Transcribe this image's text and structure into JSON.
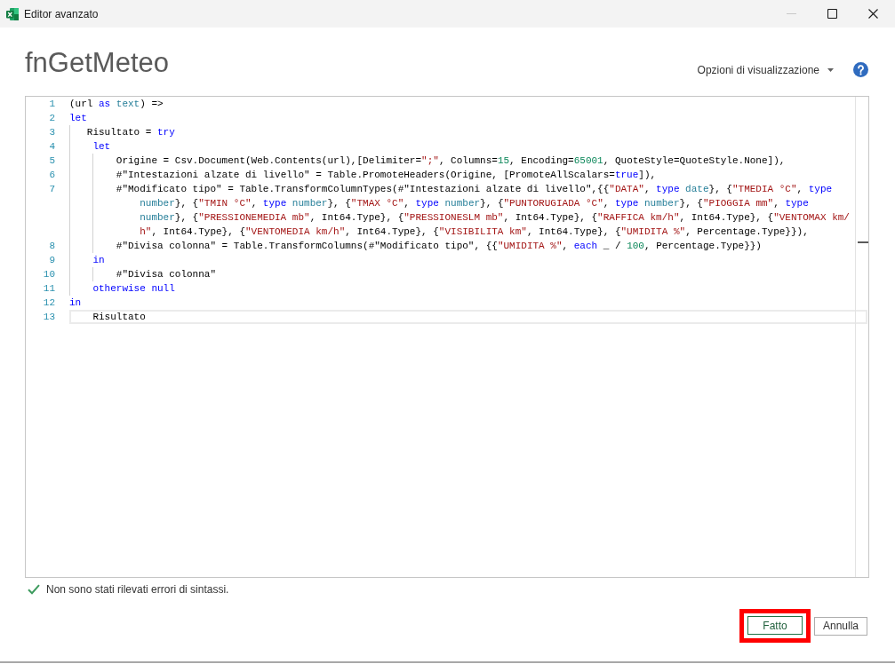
{
  "window": {
    "title": "Editor avanzato",
    "controls": [
      {
        "kind": "minimize",
        "disabled": true
      },
      {
        "kind": "maximize",
        "disabled": false
      },
      {
        "kind": "close",
        "disabled": false
      }
    ]
  },
  "query_title": "fnGetMeteo",
  "view_options": {
    "label": "Opzioni di visualizzazione"
  },
  "editor": {
    "lines": [
      {
        "number": "1",
        "current": false,
        "rows": [
          {
            "tokens": [
              {
                "text": "(url ",
                "kind": "plain"
              },
              {
                "text": "as",
                "kind": "keyword"
              },
              {
                "text": " text",
                "kind": "type"
              },
              {
                "text": ") =>",
                "kind": "plain"
              }
            ]
          }
        ]
      },
      {
        "number": "2",
        "current": false,
        "rows": [
          {
            "tokens": [
              {
                "text": "let",
                "kind": "keyword"
              }
            ]
          }
        ]
      },
      {
        "number": "3",
        "current": false,
        "rows": [
          {
            "tokens": [
              {
                "text": "   Risultato = ",
                "kind": "plain"
              },
              {
                "text": "try",
                "kind": "keyword"
              }
            ]
          }
        ]
      },
      {
        "number": "4",
        "current": false,
        "rows": [
          {
            "tokens": [
              {
                "text": "    let",
                "kind": "keyword"
              }
            ]
          }
        ]
      },
      {
        "number": "5",
        "current": false,
        "rows": [
          {
            "tokens": [
              {
                "text": "        Origine = Csv.Document(Web.Contents(url),[Delimiter=",
                "kind": "plain"
              },
              {
                "text": "\";\"",
                "kind": "string"
              },
              {
                "text": ", Columns=",
                "kind": "plain"
              },
              {
                "text": "15",
                "kind": "number"
              },
              {
                "text": ", Encoding=",
                "kind": "plain"
              },
              {
                "text": "65001",
                "kind": "number"
              },
              {
                "text": ", QuoteStyle=QuoteStyle.None]),",
                "kind": "plain"
              }
            ]
          }
        ]
      },
      {
        "number": "6",
        "current": false,
        "rows": [
          {
            "tokens": [
              {
                "text": "        #\"Intestazioni alzate di livello\" = Table.PromoteHeaders(Origine, [PromoteAllScalars=",
                "kind": "plain"
              },
              {
                "text": "true",
                "kind": "keyword"
              },
              {
                "text": "]),",
                "kind": "plain"
              }
            ]
          }
        ]
      },
      {
        "number": "7",
        "current": false,
        "rows": [
          {
            "tokens": [
              {
                "text": "        #\"Modificato tipo\" = Table.TransformColumnTypes(#\"Intestazioni alzate di livello\",{{",
                "kind": "plain"
              },
              {
                "text": "\"DATA\"",
                "kind": "string"
              },
              {
                "text": ", ",
                "kind": "plain"
              },
              {
                "text": "type",
                "kind": "keyword"
              },
              {
                "text": " date",
                "kind": "type"
              },
              {
                "text": "}, {",
                "kind": "plain"
              },
              {
                "text": "\"TMEDIA °C\"",
                "kind": "string"
              },
              {
                "text": ", ",
                "kind": "plain"
              },
              {
                "text": "type",
                "kind": "keyword"
              }
            ]
          },
          {
            "tokens": [
              {
                "text": "number",
                "kind": "type"
              },
              {
                "text": "}, {",
                "kind": "plain"
              },
              {
                "text": "\"TMIN °C\"",
                "kind": "string"
              },
              {
                "text": ", ",
                "kind": "plain"
              },
              {
                "text": "type",
                "kind": "keyword"
              },
              {
                "text": " number",
                "kind": "type"
              },
              {
                "text": "}, {",
                "kind": "plain"
              },
              {
                "text": "\"TMAX °C\"",
                "kind": "string"
              },
              {
                "text": ", ",
                "kind": "plain"
              },
              {
                "text": "type",
                "kind": "keyword"
              },
              {
                "text": " number",
                "kind": "type"
              },
              {
                "text": "}, {",
                "kind": "plain"
              },
              {
                "text": "\"PUNTORUGIADA °C\"",
                "kind": "string"
              },
              {
                "text": ", ",
                "kind": "plain"
              },
              {
                "text": "type",
                "kind": "keyword"
              },
              {
                "text": " number",
                "kind": "type"
              },
              {
                "text": "}, {",
                "kind": "plain"
              },
              {
                "text": "\"PIOGGIA mm\"",
                "kind": "string"
              },
              {
                "text": ", ",
                "kind": "plain"
              },
              {
                "text": "type",
                "kind": "keyword"
              }
            ]
          },
          {
            "tokens": [
              {
                "text": "number",
                "kind": "type"
              },
              {
                "text": "}, {",
                "kind": "plain"
              },
              {
                "text": "\"PRESSIONEMEDIA mb\"",
                "kind": "string"
              },
              {
                "text": ", Int64.Type}, {",
                "kind": "plain"
              },
              {
                "text": "\"PRESSIONESLM mb\"",
                "kind": "string"
              },
              {
                "text": ", Int64.Type}, {",
                "kind": "plain"
              },
              {
                "text": "\"RAFFICA km/h\"",
                "kind": "string"
              },
              {
                "text": ", Int64.Type}, {",
                "kind": "plain"
              },
              {
                "text": "\"VENTOMAX km/",
                "kind": "string"
              }
            ]
          },
          {
            "tokens": [
              {
                "text": "h\"",
                "kind": "string"
              },
              {
                "text": ", Int64.Type}, {",
                "kind": "plain"
              },
              {
                "text": "\"VENTOMEDIA km/h\"",
                "kind": "string"
              },
              {
                "text": ", Int64.Type}, {",
                "kind": "plain"
              },
              {
                "text": "\"VISIBILITA km\"",
                "kind": "string"
              },
              {
                "text": ", Int64.Type}, {",
                "kind": "plain"
              },
              {
                "text": "\"UMIDITA %\"",
                "kind": "string"
              },
              {
                "text": ", Percentage.Type}}),",
                "kind": "plain"
              }
            ]
          }
        ]
      },
      {
        "number": "8",
        "current": false,
        "rows": [
          {
            "tokens": [
              {
                "text": "        #\"Divisa colonna\" = Table.TransformColumns(#\"Modificato tipo\", {{",
                "kind": "plain"
              },
              {
                "text": "\"UMIDITA %\"",
                "kind": "string"
              },
              {
                "text": ", ",
                "kind": "plain"
              },
              {
                "text": "each",
                "kind": "keyword"
              },
              {
                "text": " _ / ",
                "kind": "plain"
              },
              {
                "text": "100",
                "kind": "number"
              },
              {
                "text": ", Percentage.Type}})",
                "kind": "plain"
              }
            ]
          }
        ]
      },
      {
        "number": "9",
        "current": false,
        "rows": [
          {
            "tokens": [
              {
                "text": "    in",
                "kind": "keyword"
              }
            ]
          }
        ]
      },
      {
        "number": "10",
        "current": false,
        "rows": [
          {
            "tokens": [
              {
                "text": "        #\"Divisa colonna\"",
                "kind": "plain"
              }
            ]
          }
        ]
      },
      {
        "number": "11",
        "current": false,
        "rows": [
          {
            "tokens": [
              {
                "text": "    otherwise null",
                "kind": "keyword"
              }
            ]
          }
        ]
      },
      {
        "number": "12",
        "current": false,
        "rows": [
          {
            "tokens": [
              {
                "text": "in",
                "kind": "keyword"
              }
            ]
          }
        ]
      },
      {
        "number": "13",
        "current": true,
        "rows": [
          {
            "tokens": [
              {
                "text": "    Risultato",
                "kind": "plain"
              }
            ]
          }
        ]
      }
    ]
  },
  "status": {
    "kind": "ok",
    "message": "Non sono stati rilevati errori di sintassi."
  },
  "buttons": [
    {
      "label": "Fatto",
      "kind": "confirm",
      "highlighted": true
    },
    {
      "label": "Annulla",
      "kind": "cancel",
      "highlighted": false
    }
  ]
}
